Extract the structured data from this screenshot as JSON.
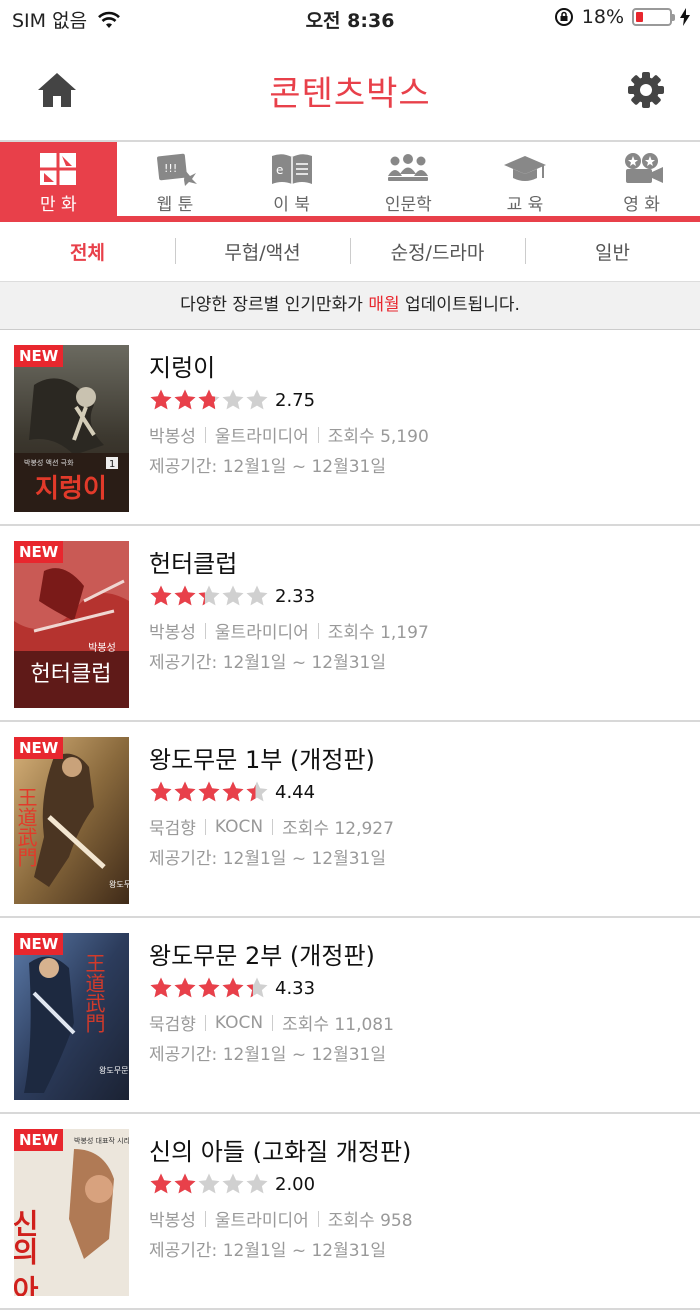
{
  "status": {
    "carrier": "SIM 없음",
    "time": "오전 8:36",
    "battery": "18%",
    "battery_level": 0.18
  },
  "header": {
    "title": "콘텐츠박스"
  },
  "categories": [
    {
      "label": "만 화",
      "icon": "comic-icon",
      "active": true
    },
    {
      "label": "웹 툰",
      "icon": "webtoon-icon",
      "active": false
    },
    {
      "label": "이 북",
      "icon": "ebook-icon",
      "active": false
    },
    {
      "label": "인문학",
      "icon": "people-icon",
      "active": false
    },
    {
      "label": "교 육",
      "icon": "graduation-cap-icon",
      "active": false
    },
    {
      "label": "영 화",
      "icon": "movie-camera-icon",
      "active": false
    }
  ],
  "subtabs": [
    {
      "label": "전체",
      "active": true
    },
    {
      "label": "무협/액션",
      "active": false
    },
    {
      "label": "순정/드라마",
      "active": false
    },
    {
      "label": "일반",
      "active": false
    }
  ],
  "notice": {
    "before": "다양한 장르별 인기만화가 ",
    "highlight": "매월",
    "after": " 업데이트됩니다."
  },
  "items": [
    {
      "badge": "NEW",
      "title": "지렁이",
      "rating": 2.75,
      "rating_text": "2.75",
      "author": "박봉성",
      "publisher": "울트라미디어",
      "views": "조회수 5,190",
      "period": "제공기간: 12월1일 ~ 12월31일",
      "cover_text": "지렁이",
      "cover_sub": "박봉성 액션 극화",
      "cover_num": "1"
    },
    {
      "badge": "NEW",
      "title": "헌터클럽",
      "rating": 2.33,
      "rating_text": "2.33",
      "author": "박봉성",
      "publisher": "울트라미디어",
      "views": "조회수 1,197",
      "period": "제공기간: 12월1일 ~ 12월31일",
      "cover_text": "헌터클럽",
      "cover_sub": "박봉성"
    },
    {
      "badge": "NEW",
      "title": "왕도무문 1부 (개정판)",
      "rating": 4.44,
      "rating_text": "4.44",
      "author": "묵검향",
      "publisher": "KOCN",
      "views": "조회수 12,927",
      "period": "제공기간: 12월1일 ~ 12월31일",
      "cover_text": "王道武門",
      "cover_sub": "왕도무문"
    },
    {
      "badge": "NEW",
      "title": "왕도무문 2부 (개정판)",
      "rating": 4.33,
      "rating_text": "4.33",
      "author": "묵검향",
      "publisher": "KOCN",
      "views": "조회수 11,081",
      "period": "제공기간: 12월1일 ~ 12월31일",
      "cover_text": "王道武門",
      "cover_sub": "왕도무문"
    },
    {
      "badge": "NEW",
      "title": "신의 아들 (고화질 개정판)",
      "rating": 2.0,
      "rating_text": "2.00",
      "author": "박봉성",
      "publisher": "울트라미디어",
      "views": "조회수 958",
      "period": "제공기간: 12월1일 ~ 12월31일",
      "cover_text": "신의 아들",
      "cover_sub": "박봉성 대표작 시리즈"
    }
  ],
  "colors": {
    "accent": "#e8404a",
    "star_on": "#e8404a",
    "star_off": "#d0d0d0"
  }
}
